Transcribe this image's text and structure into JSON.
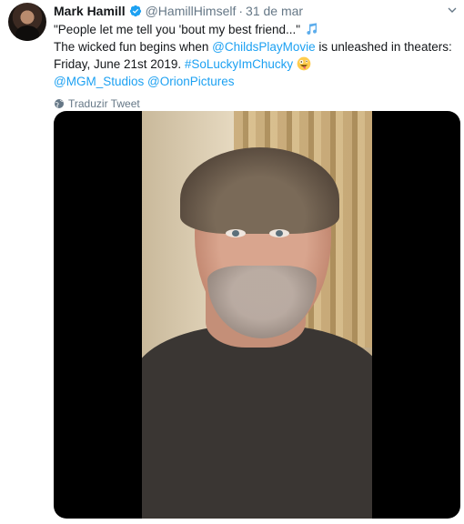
{
  "tweet": {
    "author_name": "Mark Hamill",
    "handle": "@HamillHimself",
    "separator": "·",
    "date": "31 de mar",
    "line1": "\"People let me tell you 'bout my best friend...\"",
    "line2_prefix": "The wicked fun begins when ",
    "mention_childsplay": "@ChildsPlayMovie",
    "line2_suffix": " is unleashed in theaters: Friday, June 21st 2019. ",
    "hashtag": "#SoLuckyImChucky",
    "mention_mgm": "@MGM_Studios",
    "mention_orion": "@OrionPictures",
    "translate_label": "Traduzir Tweet"
  },
  "icons": {
    "verified": "verified-badge-icon",
    "caret": "chevron-down-icon",
    "music": "music-notes-emoji",
    "zany": "zany-face-emoji",
    "globe": "globe-icon"
  },
  "colors": {
    "link": "#1da1f2",
    "muted": "#657786",
    "text": "#14171a"
  }
}
